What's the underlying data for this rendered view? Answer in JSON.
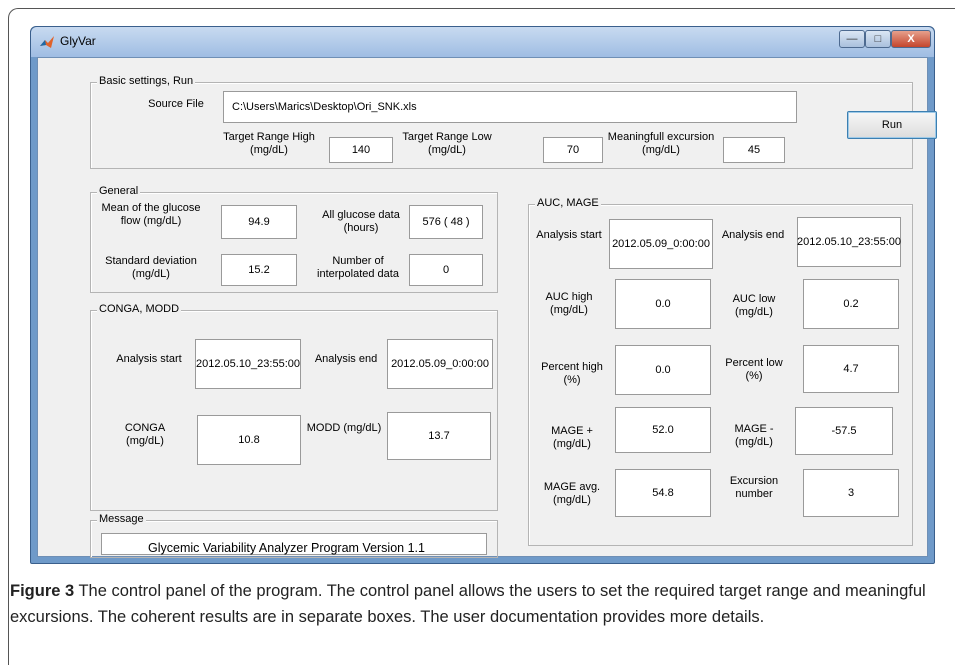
{
  "window": {
    "title": "GlyVar",
    "min_glyph": "—",
    "max_glyph": "□",
    "close_glyph": "X"
  },
  "basic": {
    "legend": "Basic settings, Run",
    "source_label": "Source File",
    "source_value": "C:\\Users\\Marics\\Desktop\\Ori_SNK.xls",
    "run_label": "Run",
    "trh_label": "Target Range High (mg/dL)",
    "trh_value": "140",
    "trl_label": "Target Range Low (mg/dL)",
    "trl_value": "70",
    "me_label": "Meaningfull  excursion (mg/dL)",
    "me_value": "45"
  },
  "general": {
    "legend": "General",
    "mean_label": "Mean of the glucose flow (mg/dL)",
    "mean_value": "94.9",
    "all_label": "All glucose data (hours)",
    "all_value": "576 ( 48 )",
    "sd_label": "Standard deviation (mg/dL)",
    "sd_value": "15.2",
    "interp_label": "Number of interpolated data",
    "interp_value": "0"
  },
  "conga": {
    "legend": "CONGA, MODD",
    "start_label": "Analysis start",
    "start_value": "2012.05.10_23:55:00",
    "end_label": "Analysis end",
    "end_value": "2012.05.09_0:00:00",
    "conga_label": "CONGA (mg/dL)",
    "conga_value": "10.8",
    "modd_label": "MODD (mg/dL)",
    "modd_value": "13.7"
  },
  "message": {
    "legend": "Message",
    "value": ""
  },
  "auc": {
    "legend": "AUC, MAGE",
    "start_label": "Analysis start",
    "start_value": "2012.05.09_0:00:00",
    "end_label": "Analysis end",
    "end_value": "2012.05.10_23:55:00",
    "auch_label": "AUC high (mg/dL)",
    "auch_value": "0.0",
    "aucl_label": "AUC low (mg/dL)",
    "aucl_value": "0.2",
    "ph_label": "Percent high (%)",
    "ph_value": "0.0",
    "pl_label": "Percent low (%)",
    "pl_value": "4.7",
    "magep_label": "MAGE + (mg/dL)",
    "magep_value": "52.0",
    "magem_label": "MAGE - (mg/dL)",
    "magem_value": "-57.5",
    "magea_label": "MAGE avg. (mg/dL)",
    "magea_value": "54.8",
    "exc_label": "Excursion number",
    "exc_value": "3"
  },
  "footer": "Glycemic Variability Analyzer Program   Version 1.1",
  "caption": {
    "bold": "Figure 3",
    "text": " The control panel of the program. The control panel allows the users to set the required target range and meaningful excursions. The coherent results are in separate boxes. The user documentation provides more details."
  }
}
